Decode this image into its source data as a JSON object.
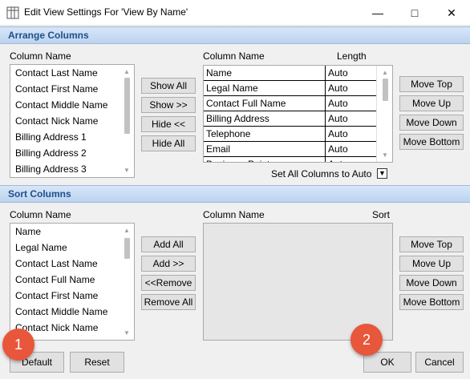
{
  "window": {
    "title": "Edit View Settings For 'View By Name'"
  },
  "arrange": {
    "header": "Arrange Columns",
    "left_label": "Column Name",
    "left_items": [
      "Contact Last Name",
      "Contact First Name",
      "Contact Middle Name",
      "Contact Nick Name",
      "Billing Address 1",
      "Billing Address 2",
      "Billing Address 3"
    ],
    "mid_buttons": [
      "Show All",
      "Show >>",
      "Hide <<",
      "Hide All"
    ],
    "grid_col1": "Column Name",
    "grid_col2": "Length",
    "grid_rows": [
      {
        "name": "Name",
        "len": "Auto"
      },
      {
        "name": "Legal Name",
        "len": "Auto"
      },
      {
        "name": "Contact Full Name",
        "len": "Auto"
      },
      {
        "name": "Billing Address",
        "len": "Auto"
      },
      {
        "name": "Telephone",
        "len": "Auto"
      },
      {
        "name": "Email",
        "len": "Auto"
      },
      {
        "name": "Business Point",
        "len": "Auto"
      }
    ],
    "right_buttons": [
      "Move Top",
      "Move Up",
      "Move Down",
      "Move Bottom"
    ],
    "set_all_label": "Set All Columns to Auto"
  },
  "sort": {
    "header": "Sort Columns",
    "left_label": "Column Name",
    "left_items": [
      "Name",
      "Legal Name",
      "Contact Last Name",
      "Contact Full Name",
      "Contact First Name",
      "Contact Middle Name",
      "Contact Nick Name"
    ],
    "mid_buttons": [
      "Add All",
      "Add >>",
      "<<Remove",
      "Remove All"
    ],
    "grid_col1": "Column Name",
    "grid_col2": "Sort",
    "right_buttons": [
      "Move Top",
      "Move Up",
      "Move Down",
      "Move Bottom"
    ]
  },
  "footer": {
    "default": "Default",
    "reset": "Reset",
    "ok": "OK",
    "cancel": "Cancel"
  },
  "badges": [
    "1",
    "2"
  ],
  "colors": {
    "accent_header": "#1f4e8c",
    "badge": "#e8563b"
  }
}
